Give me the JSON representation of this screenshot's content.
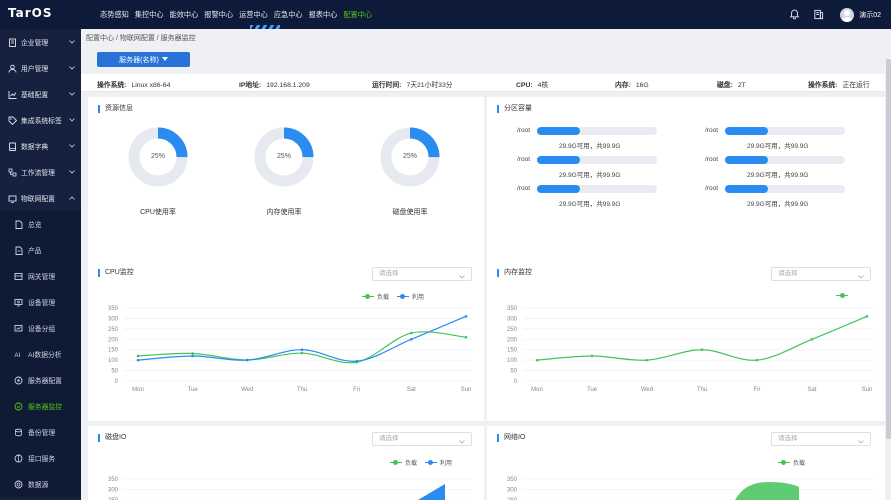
{
  "app": {
    "logo": "TarOS"
  },
  "topnav": [
    {
      "label": "态势感知",
      "active": false
    },
    {
      "label": "集控中心",
      "active": false
    },
    {
      "label": "能效中心",
      "active": false
    },
    {
      "label": "报警中心",
      "active": false
    },
    {
      "label": "运营中心",
      "active": false
    },
    {
      "label": "应急中心",
      "active": false
    },
    {
      "label": "报表中心",
      "active": false
    },
    {
      "label": "配置中心",
      "active": true
    }
  ],
  "user": {
    "name": "演示02"
  },
  "sidebar": {
    "items": [
      {
        "label": "企业管理",
        "icon": "building-icon"
      },
      {
        "label": "用户管理",
        "icon": "user-icon"
      },
      {
        "label": "基础配置",
        "icon": "chart-icon"
      },
      {
        "label": "集成系统标签",
        "icon": "tag-icon"
      },
      {
        "label": "数据字典",
        "icon": "dictionary-icon"
      },
      {
        "label": "工作流管理",
        "icon": "workflow-icon"
      },
      {
        "label": "物联网配置",
        "icon": "iot-icon"
      }
    ],
    "subitems": [
      {
        "label": "总览",
        "icon": "overview-icon",
        "active": false
      },
      {
        "label": "产品",
        "icon": "product-icon",
        "active": false
      },
      {
        "label": "网关管理",
        "icon": "gateway-icon",
        "active": false
      },
      {
        "label": "设备管理",
        "icon": "device-icon",
        "active": false
      },
      {
        "label": "设备分组",
        "icon": "group-icon",
        "active": false
      },
      {
        "label": "AI数据分析",
        "icon": "ai-icon",
        "active": false
      },
      {
        "label": "服务器配置",
        "icon": "server-config-icon",
        "active": false
      },
      {
        "label": "服务器监控",
        "icon": "monitor-icon",
        "active": true
      },
      {
        "label": "备份管理",
        "icon": "backup-icon",
        "active": false
      },
      {
        "label": "接口服务",
        "icon": "api-icon",
        "active": false
      },
      {
        "label": "数据源",
        "icon": "datasource-icon",
        "active": false
      }
    ]
  },
  "breadcrumb": "配置中心 / 物联网配置 / 服务器监控",
  "server_button": "服务器(名称)",
  "info": [
    {
      "key": "操作系统:",
      "value": "Linux x86-64"
    },
    {
      "key": "IP地址:",
      "value": "192.168.1.209"
    },
    {
      "key": "运行时间:",
      "value": "7天21小时33分"
    },
    {
      "key": "CPU:",
      "value": "4核"
    },
    {
      "key": "内存:",
      "value": "16G"
    },
    {
      "key": "磁盘:",
      "value": "2T"
    },
    {
      "key": "操作系统:",
      "value": "正在运行"
    }
  ],
  "resources": {
    "title": "资源信息",
    "items": [
      {
        "label": "CPU使用率",
        "value_text": "25%",
        "fraction": 0.25
      },
      {
        "label": "内存使用率",
        "value_text": "25%",
        "fraction": 0.25
      },
      {
        "label": "磁盘使用率",
        "value_text": "25%",
        "fraction": 0.25
      }
    ]
  },
  "partitions": {
    "title": "分区容量",
    "items": [
      {
        "name": "/root",
        "text": "29.9G可用，共99.9G",
        "fraction": 0.36
      },
      {
        "name": "/root",
        "text": "29.9G可用，共99.9G",
        "fraction": 0.36
      },
      {
        "name": "/root",
        "text": "29.9G可用，共99.9G",
        "fraction": 0.36
      },
      {
        "name": "/root",
        "text": "29.9G可用，共99.9G",
        "fraction": 0.36
      },
      {
        "name": "/root",
        "text": "29.9G可用，共99.9G",
        "fraction": 0.36
      },
      {
        "name": "/root",
        "text": "29.9G可用，共99.9G",
        "fraction": 0.36
      }
    ]
  },
  "select_placeholder": "请选择",
  "panels": {
    "cpu": "CPU监控",
    "mem": "内存监控",
    "disk": "磁盘IO",
    "net": "网络IO"
  },
  "colors": {
    "blue": "#2a8cf0",
    "green": "#45c25a",
    "accent": "#52c41a"
  },
  "chart_data": [
    {
      "type": "line",
      "categories": [
        "Mon",
        "Tue",
        "Wed",
        "Thu",
        "Fri",
        "Sat",
        "Sun"
      ],
      "ylim": [
        0,
        350
      ],
      "yticks": [
        "350",
        "300",
        "250",
        "200",
        "150",
        "100",
        "50",
        "0"
      ],
      "series": [
        {
          "name": "负载",
          "color": "#45c25a",
          "values": [
            120,
            132,
            101,
            134,
            90,
            230,
            210
          ]
        },
        {
          "name": "利用",
          "color": "#2a8cf0",
          "values": [
            100,
            120,
            100,
            150,
            95,
            200,
            310
          ]
        }
      ]
    },
    {
      "type": "line",
      "categories": [
        "Mon",
        "Tue",
        "Wed",
        "Thu",
        "Fri",
        "Sat",
        "Sun"
      ],
      "ylim": [
        0,
        350
      ],
      "yticks": [
        "350",
        "300",
        "250",
        "200",
        "150",
        "100",
        "50",
        "0"
      ],
      "series": [
        {
          "name": "",
          "color": "#45c25a",
          "values": [
            100,
            120,
            100,
            150,
            100,
            200,
            310
          ]
        }
      ]
    },
    {
      "type": "line",
      "yticks": [
        "350",
        "300",
        "250"
      ],
      "legend": [
        "负载",
        "利用"
      ]
    },
    {
      "type": "area",
      "yticks": [
        "350",
        "300",
        "250"
      ],
      "legend": [
        "负载"
      ]
    }
  ]
}
